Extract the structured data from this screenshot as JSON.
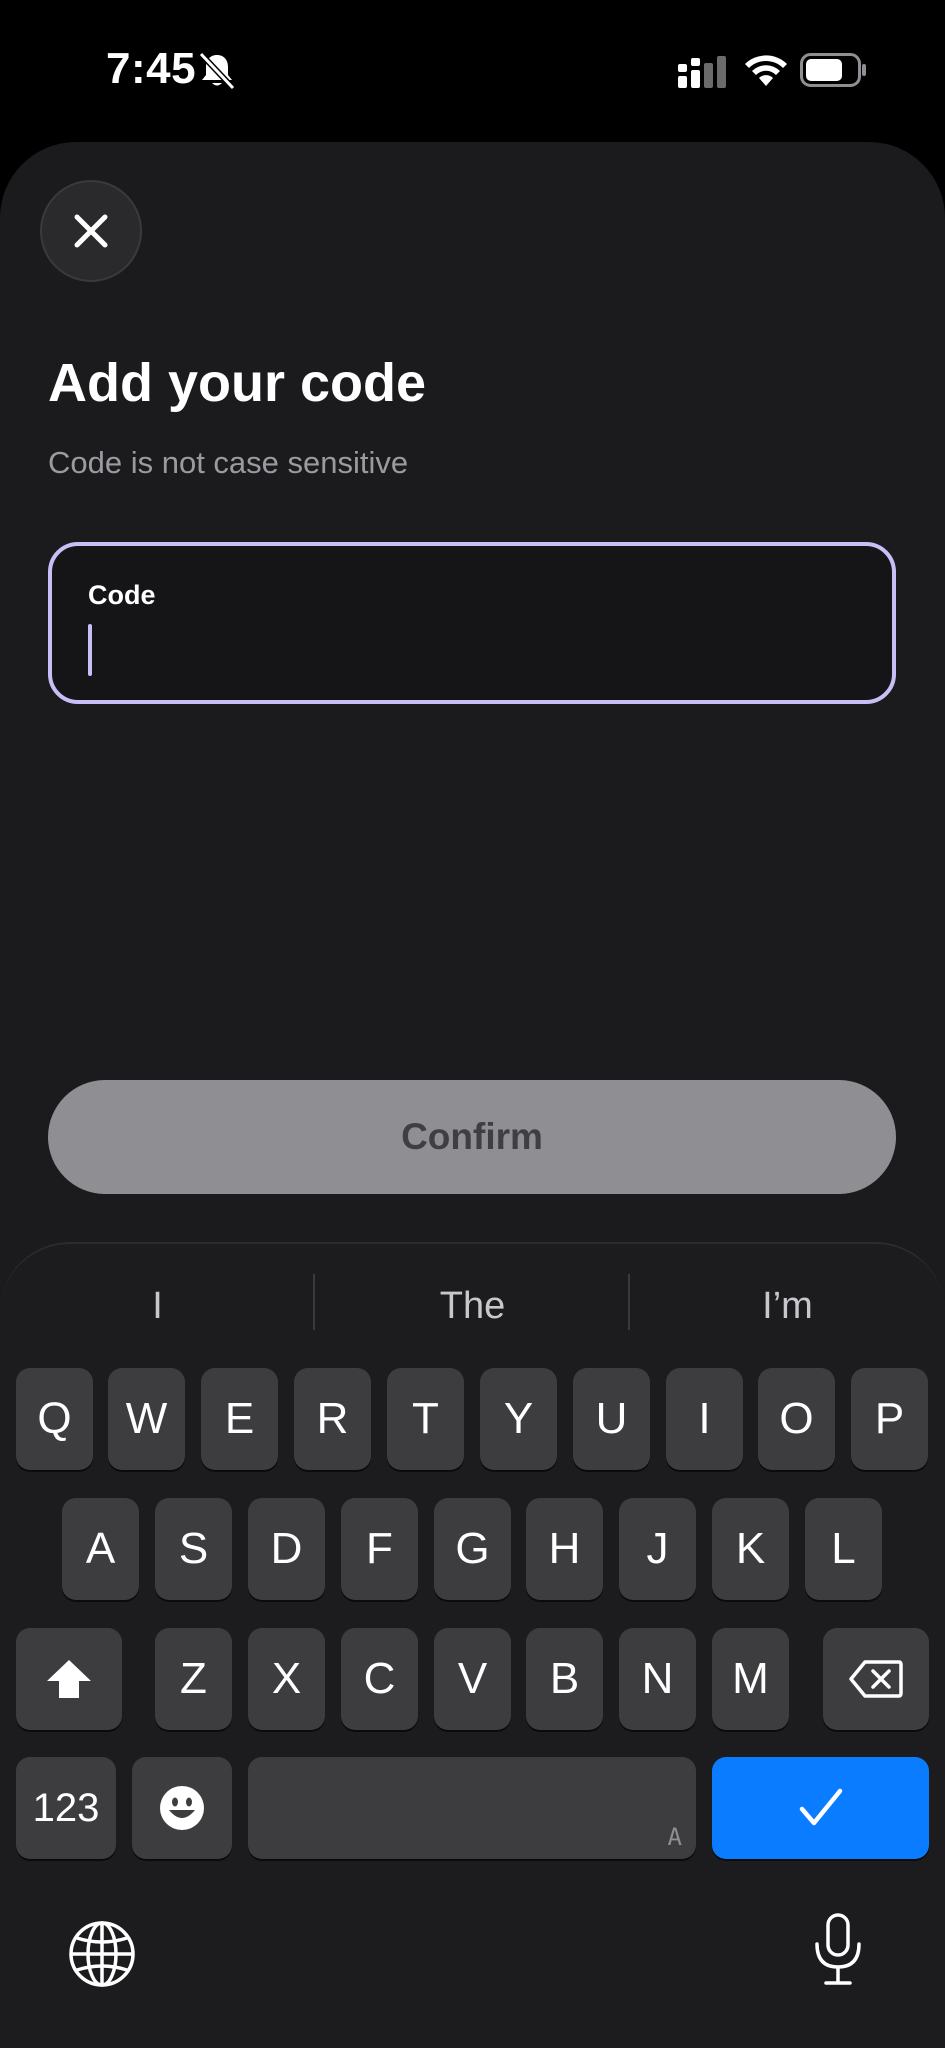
{
  "status_bar": {
    "time": "7:45",
    "icons": [
      "bell-slash-icon",
      "signal-icon",
      "wifi-icon",
      "battery-icon"
    ]
  },
  "sheet": {
    "close_icon": "close-icon",
    "title": "Add your code",
    "subtitle": "Code is not case sensitive",
    "code_field": {
      "label": "Code",
      "value": "",
      "accent_color": "#c9bff7"
    },
    "confirm_label": "Confirm"
  },
  "keyboard": {
    "suggestions": [
      "I",
      "The",
      "I’m"
    ],
    "row1": [
      "Q",
      "W",
      "E",
      "R",
      "T",
      "Y",
      "U",
      "I",
      "O",
      "P"
    ],
    "row2": [
      "A",
      "S",
      "D",
      "F",
      "G",
      "H",
      "J",
      "K",
      "L"
    ],
    "row3": [
      "Z",
      "X",
      "C",
      "V",
      "B",
      "N",
      "M"
    ],
    "numbers_label": "123",
    "space_hint": "A",
    "return_color": "#0a7cff",
    "icons": [
      "shift-icon",
      "backspace-icon",
      "emoji-icon",
      "checkmark-icon",
      "globe-icon",
      "microphone-icon"
    ]
  }
}
